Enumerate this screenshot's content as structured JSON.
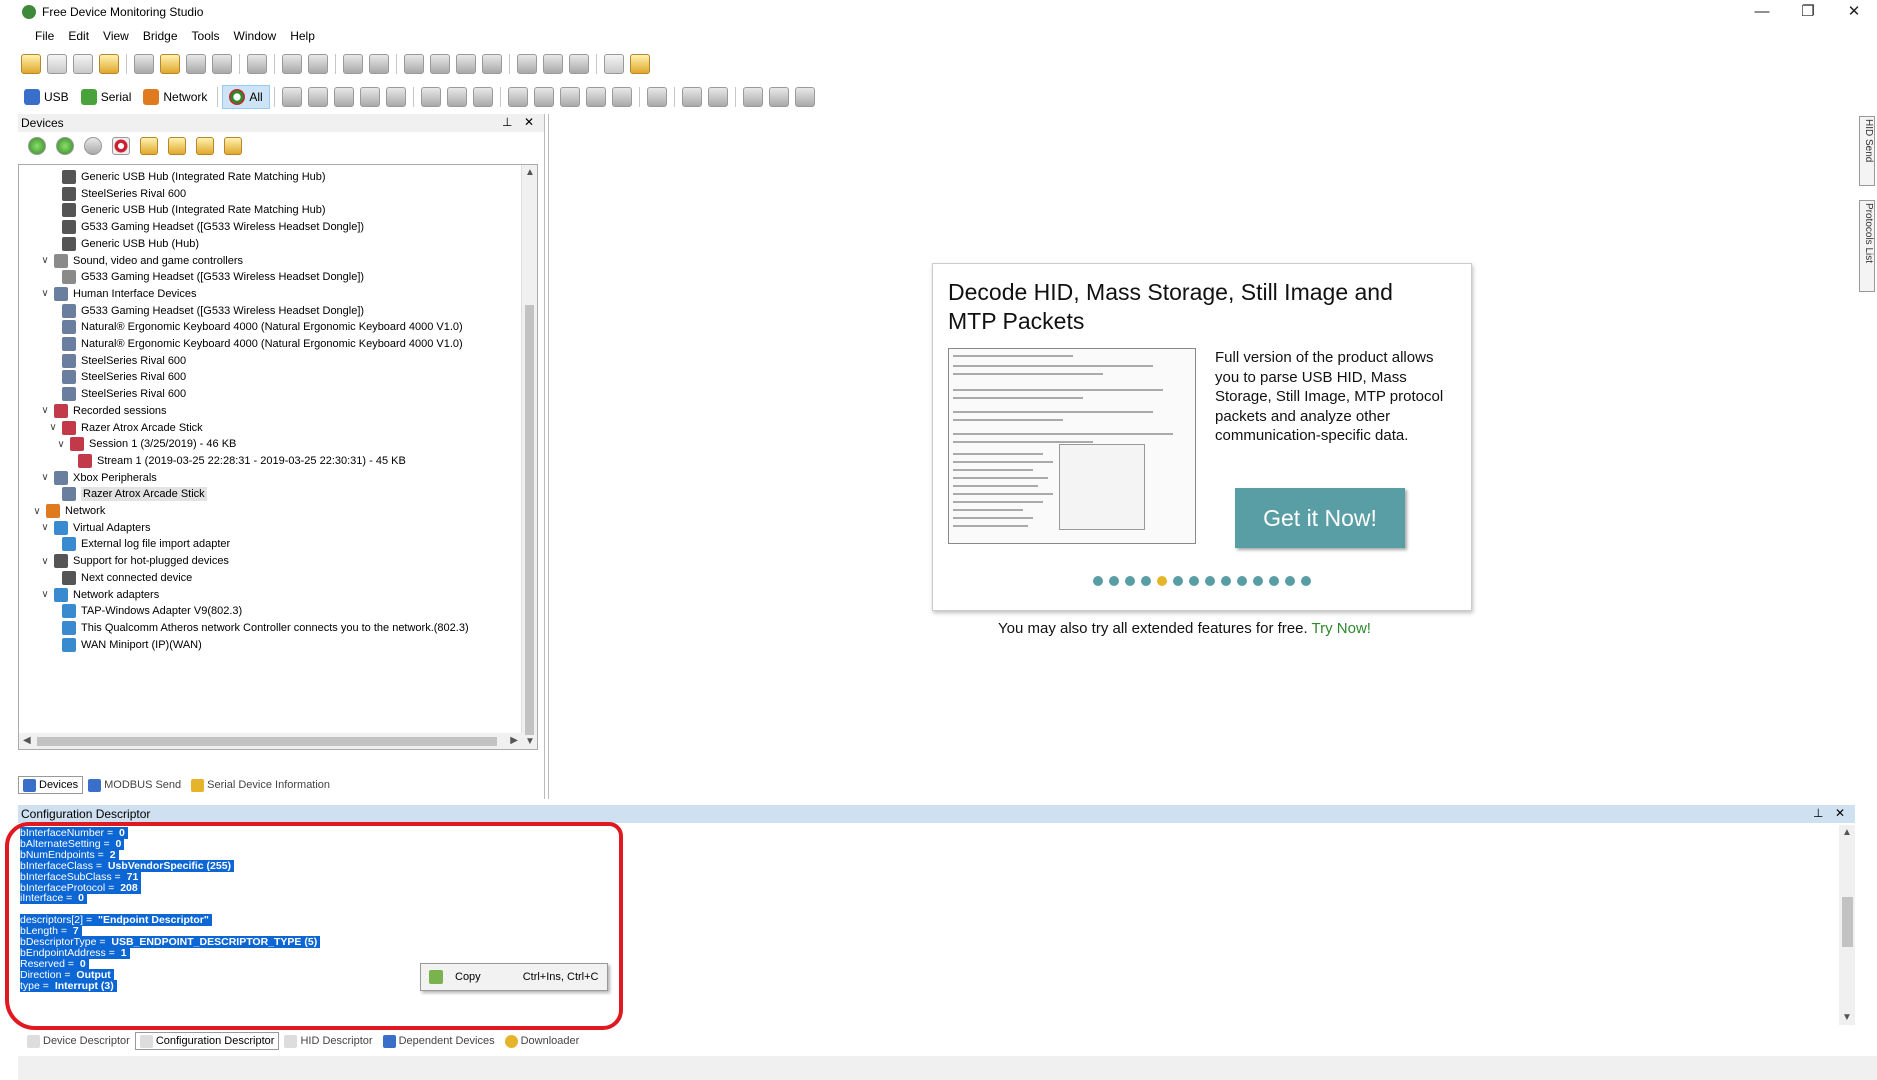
{
  "app": {
    "title": "Free Device Monitoring Studio"
  },
  "window_controls": {
    "minimize": "—",
    "maximize": "❐",
    "close": "✕"
  },
  "menu": [
    "File",
    "Edit",
    "View",
    "Bridge",
    "Tools",
    "Window",
    "Help"
  ],
  "filter_toolbar": {
    "usb": "USB",
    "serial": "Serial",
    "network": "Network",
    "all": "All"
  },
  "devices_panel": {
    "title": "Devices",
    "tree": [
      {
        "label": "Generic USB Hub (Integrated Rate Matching Hub)",
        "level": 3,
        "icon": "usb-plug-icon",
        "expander": ""
      },
      {
        "label": "SteelSeries Rival 600",
        "level": 3,
        "icon": "usb-plug-icon",
        "expander": ""
      },
      {
        "label": "Generic USB Hub (Integrated Rate Matching Hub)",
        "level": 3,
        "icon": "usb-plug-icon",
        "expander": ""
      },
      {
        "label": "G533 Gaming Headset ([G533 Wireless Headset Dongle])",
        "level": 3,
        "icon": "usb-plug-icon",
        "expander": ""
      },
      {
        "label": "Generic USB Hub (Hub)",
        "level": 3,
        "icon": "usb-plug-icon",
        "expander": ""
      },
      {
        "label": "Sound, video and game controllers",
        "level": 2,
        "icon": "speaker-icon",
        "expander": "∨"
      },
      {
        "label": "G533 Gaming Headset ([G533 Wireless Headset Dongle])",
        "level": 3,
        "icon": "speaker-icon",
        "expander": ""
      },
      {
        "label": "Human Interface Devices",
        "level": 2,
        "icon": "hid-icon",
        "expander": "∨"
      },
      {
        "label": "G533 Gaming Headset ([G533 Wireless Headset Dongle])",
        "level": 3,
        "icon": "hid-icon",
        "expander": ""
      },
      {
        "label": "Natural® Ergonomic Keyboard 4000 (Natural Ergonomic Keyboard 4000 V1.0)",
        "level": 3,
        "icon": "hid-icon",
        "expander": ""
      },
      {
        "label": "Natural® Ergonomic Keyboard 4000 (Natural Ergonomic Keyboard 4000 V1.0)",
        "level": 3,
        "icon": "hid-icon",
        "expander": ""
      },
      {
        "label": "SteelSeries Rival 600",
        "level": 3,
        "icon": "hid-icon",
        "expander": ""
      },
      {
        "label": "SteelSeries Rival 600",
        "level": 3,
        "icon": "hid-icon",
        "expander": ""
      },
      {
        "label": "SteelSeries Rival 600",
        "level": 3,
        "icon": "hid-icon",
        "expander": ""
      },
      {
        "label": "Recorded sessions",
        "level": 2,
        "icon": "session-icon",
        "expander": "∨"
      },
      {
        "label": "Razer Atrox Arcade Stick",
        "level": 3,
        "icon": "session-icon",
        "expander": "∨"
      },
      {
        "label": "Session 1 (3/25/2019) - 46 KB",
        "level": 4,
        "icon": "session-icon",
        "expander": "∨"
      },
      {
        "label": "Stream 1 (2019-03-25 22:28:31 - 2019-03-25 22:30:31) - 45 KB",
        "level": 5,
        "icon": "session-icon",
        "expander": ""
      },
      {
        "label": "Xbox Peripherals",
        "level": 2,
        "icon": "hid-icon",
        "expander": "∨"
      },
      {
        "label": "Razer Atrox Arcade Stick",
        "level": 3,
        "icon": "hid-icon",
        "expander": "",
        "selected": true
      },
      {
        "label": "Network",
        "level": 1,
        "icon": "network-icon",
        "expander": "∨"
      },
      {
        "label": "Virtual Adapters",
        "level": 2,
        "icon": "adapter-icon",
        "expander": "∨"
      },
      {
        "label": "External log file import adapter",
        "level": 3,
        "icon": "adapter-icon",
        "expander": ""
      },
      {
        "label": "Support for hot-plugged devices",
        "level": 2,
        "icon": "hotplug-icon",
        "expander": "∨"
      },
      {
        "label": "Next connected device",
        "level": 3,
        "icon": "hotplug-icon",
        "expander": ""
      },
      {
        "label": "Network adapters",
        "level": 2,
        "icon": "adapter-icon",
        "expander": "∨"
      },
      {
        "label": "TAP-Windows Adapter V9(802.3)",
        "level": 3,
        "icon": "adapter-icon",
        "expander": ""
      },
      {
        "label": "This Qualcomm Atheros network Controller connects you to the network.(802.3)",
        "level": 3,
        "icon": "adapter-icon",
        "expander": ""
      },
      {
        "label": "WAN Miniport (IP)(WAN)",
        "level": 3,
        "icon": "adapter-icon",
        "expander": ""
      }
    ],
    "tabs": [
      "Devices",
      "MODBUS Send",
      "Serial Device Information"
    ]
  },
  "promo": {
    "headline": "Decode HID, Mass Storage, Still Image and MTP Packets",
    "description": "Full version of the product allows you to parse USB HID, Mass Storage, Still Image, MTP protocol packets and analyze other communication-specific data.",
    "button": "Get it Now!",
    "slides_total": 14,
    "slide_active": 5,
    "try_text": "You may also try all extended features for free.",
    "try_link": "Try Now!"
  },
  "side_tabs": [
    "HID Send",
    "Protocols List"
  ],
  "config_panel": {
    "title": "Configuration Descriptor",
    "lines": [
      {
        "text": "bInterfaceNumber = ",
        "value": "0"
      },
      {
        "text": "bAlternateSetting = ",
        "value": "0"
      },
      {
        "text": "bNumEndpoints = ",
        "value": "2"
      },
      {
        "text": "bInterfaceClass = ",
        "value": "UsbVendorSpecific (255)"
      },
      {
        "text": "bInterfaceSubClass = ",
        "value": "71"
      },
      {
        "text": "bInterfaceProtocol = ",
        "value": "208"
      },
      {
        "text": "iInterface = ",
        "value": "0"
      },
      {
        "text": "",
        "value": ""
      },
      {
        "text": "descriptors[2] = ",
        "value": "\"Endpoint Descriptor\""
      },
      {
        "text": "bLength = ",
        "value": "7"
      },
      {
        "text": "bDescriptorType = ",
        "value": "USB_ENDPOINT_DESCRIPTOR_TYPE (5)"
      },
      {
        "text": "bEndpointAddress = ",
        "value": "1"
      },
      {
        "text": "Reserved = ",
        "value": "0"
      },
      {
        "text": "Direction = ",
        "value": "Output"
      },
      {
        "text": "type = ",
        "value": "Interrupt (3)"
      }
    ],
    "context_menu": {
      "label": "Copy",
      "shortcut": "Ctrl+Ins, Ctrl+C"
    },
    "tabs": [
      "Device Descriptor",
      "Configuration Descriptor",
      "HID Descriptor",
      "Dependent Devices",
      "Downloader"
    ]
  },
  "colors": {
    "selection": "#0c66d3",
    "accent": "#5a9ea5",
    "annotation": "#e01820",
    "link": "#2d8a2d"
  }
}
